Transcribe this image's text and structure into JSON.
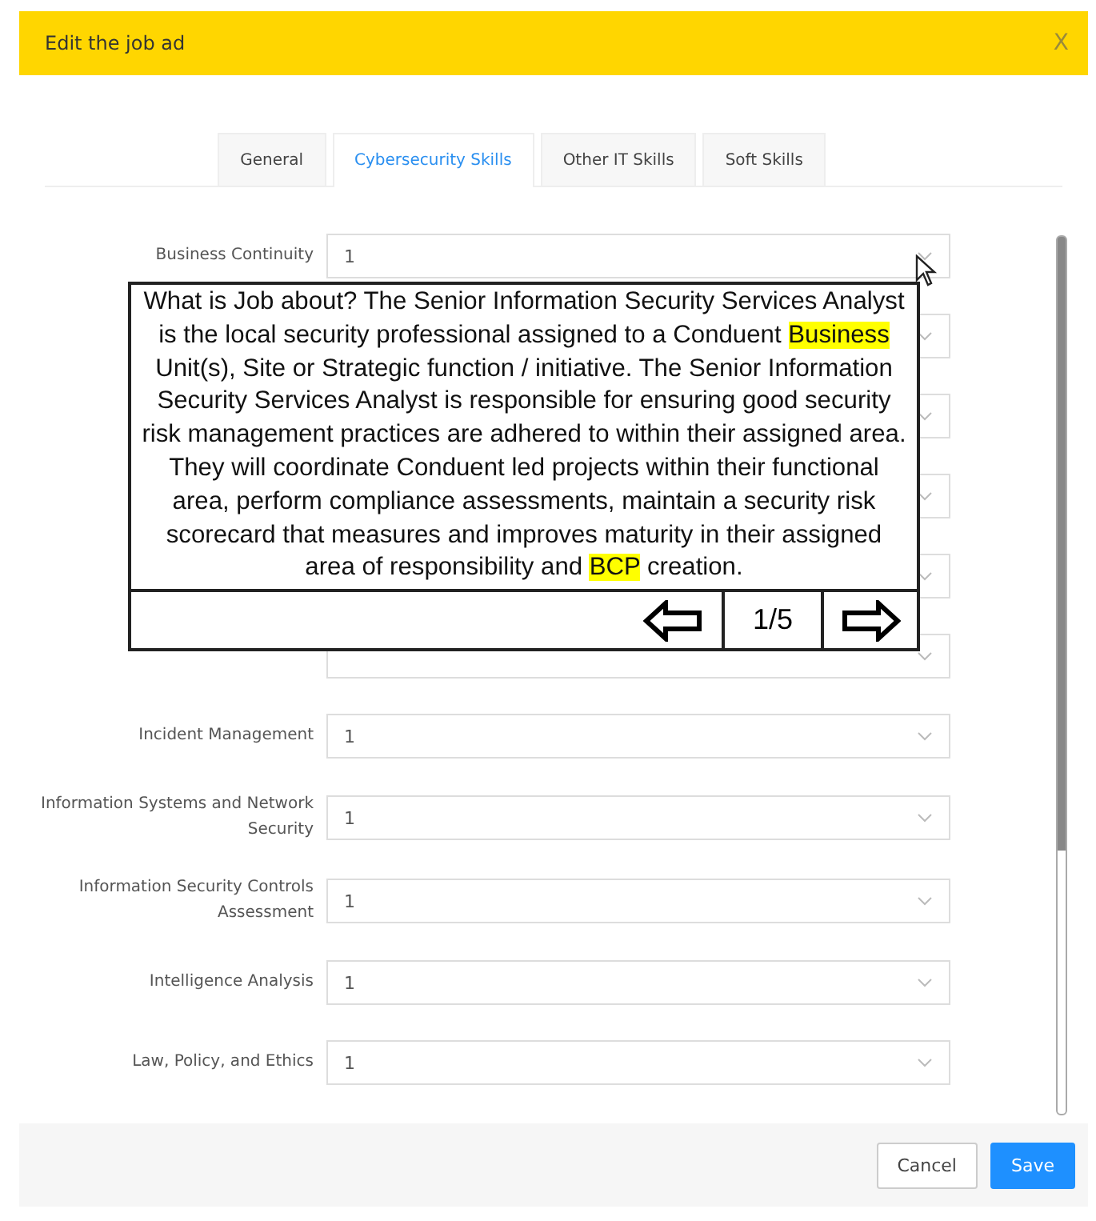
{
  "dialog": {
    "title": "Edit the job ad",
    "close": "X"
  },
  "tabs": [
    {
      "label": "General",
      "selected": false
    },
    {
      "label": "Cybersecurity Skills",
      "selected": true
    },
    {
      "label": "Other IT Skills",
      "selected": false
    },
    {
      "label": "Soft Skills",
      "selected": false
    }
  ],
  "fields": [
    {
      "kind": "visible",
      "label": "Business Continuity",
      "value": "1"
    },
    {
      "kind": "covered"
    },
    {
      "kind": "covered"
    },
    {
      "kind": "covered"
    },
    {
      "kind": "covered"
    },
    {
      "kind": "covered"
    },
    {
      "kind": "visible",
      "label": "Incident Management",
      "value": "1"
    },
    {
      "kind": "visible",
      "label": "Information Systems and Network Security",
      "value": "1"
    },
    {
      "kind": "visible",
      "label": "Information Security Controls Assessment",
      "value": "1"
    },
    {
      "kind": "visible",
      "label": "Intelligence Analysis",
      "value": "1"
    },
    {
      "kind": "visible",
      "label": "Law, Policy, and Ethics",
      "value": "1"
    }
  ],
  "popup": {
    "segments": [
      {
        "text": "What is Job about? The Senior Information Security Services Analyst is the local security professional assigned to a Conduent ",
        "highlighted": false
      },
      {
        "text": "Business",
        "highlighted": true
      },
      {
        "text": " Unit(s), Site or Strategic function / initiative. The Senior Information Security Services Analyst is responsible for ensuring good security risk management practices are adhered to within their assigned area. They will coordinate Conduent led projects within their functional area, perform compliance assessments, maintain a security risk scorecard that measures and improves maturity in their assigned area of responsibility and ",
        "highlighted": false
      },
      {
        "text": "BCP",
        "highlighted": true
      },
      {
        "text": " creation.",
        "highlighted": false
      }
    ],
    "page": "1/5"
  },
  "footer": {
    "buttons": [
      {
        "label": "Cancel",
        "kind": "default"
      },
      {
        "label": "Save",
        "kind": "primary"
      }
    ]
  }
}
